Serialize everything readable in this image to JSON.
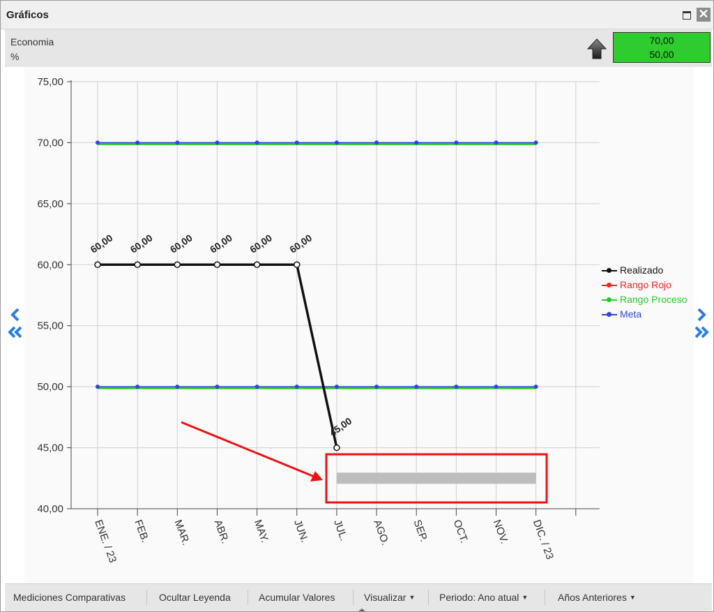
{
  "window": {
    "title": "Gráficos"
  },
  "header": {
    "metric_name": "Economia",
    "unit": "%",
    "trend_icon": "arrow-up-icon"
  },
  "targets": {
    "upper": "70,00",
    "lower": "50,00",
    "color": "#2ecc2e"
  },
  "legend": [
    {
      "label": "Realizado",
      "color": "#111111"
    },
    {
      "label": "Rango Rojo",
      "color": "#ff2020"
    },
    {
      "label": "Rango Proceso",
      "color": "#22cc22"
    },
    {
      "label": "Meta",
      "color": "#3344dd"
    }
  ],
  "toolbar": {
    "comparativas": "Mediciones Comparativas",
    "ocultar": "Ocultar Leyenda",
    "acumular": "Acumular Valores",
    "visualizar": "Visualizar",
    "periodo": "Periodo: Ano atual",
    "anos": "Años Anteriores"
  },
  "chart_data": {
    "type": "line",
    "categories": [
      "ENE. / 23",
      "FEB.",
      "MAR.",
      "ABR.",
      "MAY.",
      "JUN.",
      "JUL.",
      "AGO.",
      "SEP.",
      "OCT.",
      "NOV.",
      "DIC. / 23",
      ""
    ],
    "ylim": [
      40,
      75
    ],
    "yticks": [
      "40,00",
      "45,00",
      "50,00",
      "55,00",
      "60,00",
      "65,00",
      "70,00",
      "75,00"
    ],
    "grid": true,
    "legend_position": "right",
    "series": [
      {
        "name": "Realizado",
        "color": "#111111",
        "values": [
          60,
          60,
          60,
          60,
          60,
          60,
          45,
          null,
          null,
          null,
          null,
          null
        ],
        "labels": [
          "60,00",
          "60,00",
          "60,00",
          "60,00",
          "60,00",
          "60,00",
          "45,00"
        ]
      },
      {
        "name": "Rango Proceso",
        "color": "#22cc22",
        "values": [
          70,
          70,
          70,
          70,
          70,
          70,
          70,
          70,
          70,
          70,
          70,
          70
        ]
      },
      {
        "name": "Meta",
        "color": "#3344dd",
        "values": [
          70,
          70,
          70,
          70,
          70,
          70,
          70,
          70,
          70,
          70,
          70,
          70
        ]
      },
      {
        "name": "Rango Proceso",
        "color": "#22cc22",
        "values": [
          50,
          50,
          50,
          50,
          50,
          50,
          50,
          50,
          50,
          50,
          50,
          50
        ]
      },
      {
        "name": "Meta",
        "color": "#3344dd",
        "values": [
          50,
          50,
          50,
          50,
          50,
          50,
          50,
          50,
          50,
          50,
          50,
          50
        ]
      }
    ],
    "annotations": {
      "gray_bar_range": [
        6,
        11
      ],
      "gray_bar_value": 42.5
    }
  }
}
